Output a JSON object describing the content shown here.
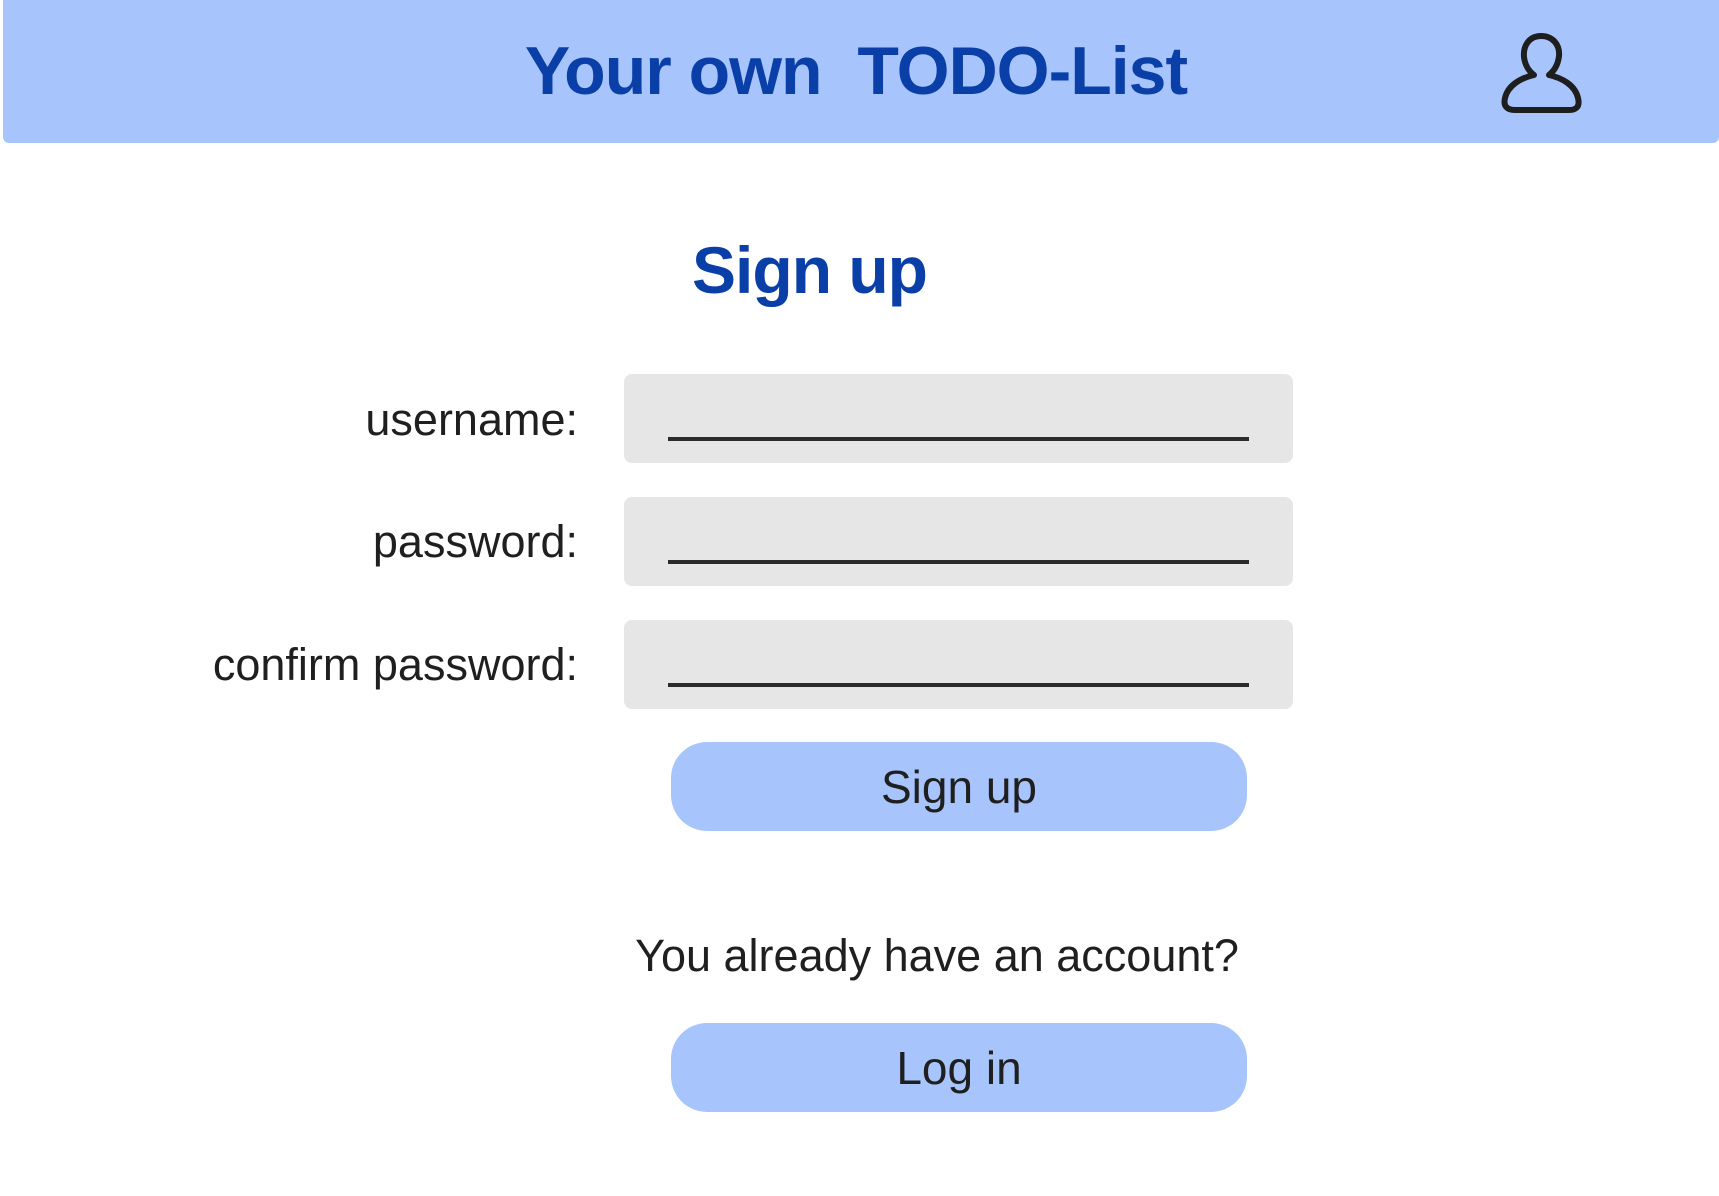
{
  "header": {
    "title": "Your own  TODO-List",
    "user_icon": "user-icon"
  },
  "page_title": "Sign up",
  "form": {
    "fields": [
      {
        "label": "username:",
        "value": "",
        "placeholder": ""
      },
      {
        "label": "password:",
        "value": "",
        "placeholder": ""
      },
      {
        "label": "confirm password:",
        "value": "",
        "placeholder": ""
      }
    ],
    "submit_label": "Sign up"
  },
  "account_prompt": "You already have an account?",
  "login_label": "Log in",
  "colors": {
    "accent": "#a7c5fc",
    "brand_text": "#0a3fa8",
    "field_bg": "#e6e6e6"
  }
}
